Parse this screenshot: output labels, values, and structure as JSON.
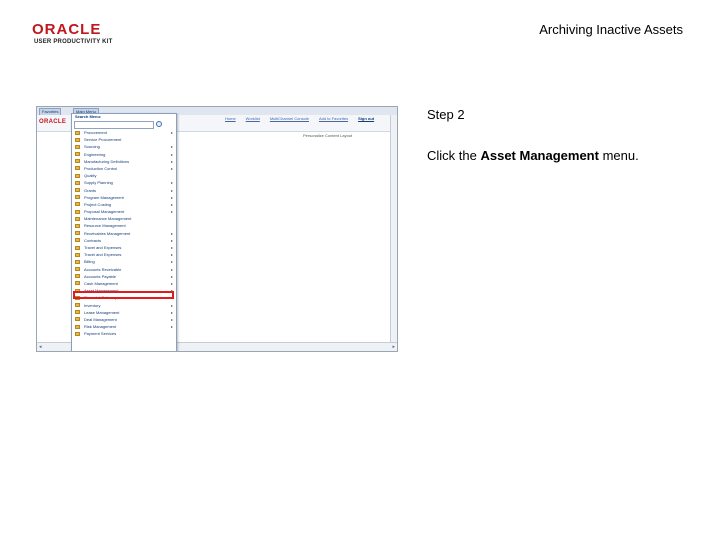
{
  "header": {
    "logo_text": "ORACLE",
    "logo_subtitle": "USER PRODUCTIVITY KIT",
    "doc_title": "Archiving Inactive Assets"
  },
  "step": {
    "label": "Step 2",
    "instruction_prefix": "Click the ",
    "instruction_bold": "Asset Management",
    "instruction_suffix": " menu."
  },
  "screenshot": {
    "tabs": [
      "Favorites",
      "Main Menu"
    ],
    "menu_title": "Search Menu:",
    "header_links": [
      "Home",
      "Worklist",
      "MultiChannel Console",
      "Add to Favorites",
      "Sign out"
    ],
    "subbar_text": "Personalize Content   Layout",
    "menu_items": [
      {
        "label": "Procurement",
        "arrow": true
      },
      {
        "label": "Service Procurement",
        "arrow": false
      },
      {
        "label": "Sourcing",
        "arrow": true
      },
      {
        "label": "Engineering",
        "arrow": true
      },
      {
        "label": "Manufacturing Definitions",
        "arrow": true
      },
      {
        "label": "Production Control",
        "arrow": true
      },
      {
        "label": "Quality",
        "arrow": false
      },
      {
        "label": "Supply Planning",
        "arrow": true
      },
      {
        "label": "Grants",
        "arrow": true
      },
      {
        "label": "Program Management",
        "arrow": true
      },
      {
        "label": "Project Costing",
        "arrow": true
      },
      {
        "label": "Proposal Management",
        "arrow": true
      },
      {
        "label": "Maintenance Management",
        "arrow": false
      },
      {
        "label": "Resource Management",
        "arrow": false
      },
      {
        "label": "Receivables Management",
        "arrow": true
      },
      {
        "label": "Contracts",
        "arrow": true
      },
      {
        "label": "Travel and Expenses",
        "arrow": true
      },
      {
        "label": "Travel and Expenses",
        "arrow": true
      },
      {
        "label": "Billing",
        "arrow": true
      },
      {
        "label": "Accounts Receivable",
        "arrow": true
      },
      {
        "label": "Accounts Payable",
        "arrow": true
      },
      {
        "label": "Cash Management",
        "arrow": true
      },
      {
        "label": "Asset Management",
        "arrow": true
      },
      {
        "label": "Financial Gateway",
        "arrow": true
      },
      {
        "label": "Inventory",
        "arrow": true
      },
      {
        "label": "Lease Management",
        "arrow": true
      },
      {
        "label": "Deal Management",
        "arrow": true
      },
      {
        "label": "Risk Management",
        "arrow": true
      },
      {
        "label": "Payment Services",
        "arrow": false
      }
    ],
    "highlighted_item": "Asset Management"
  }
}
